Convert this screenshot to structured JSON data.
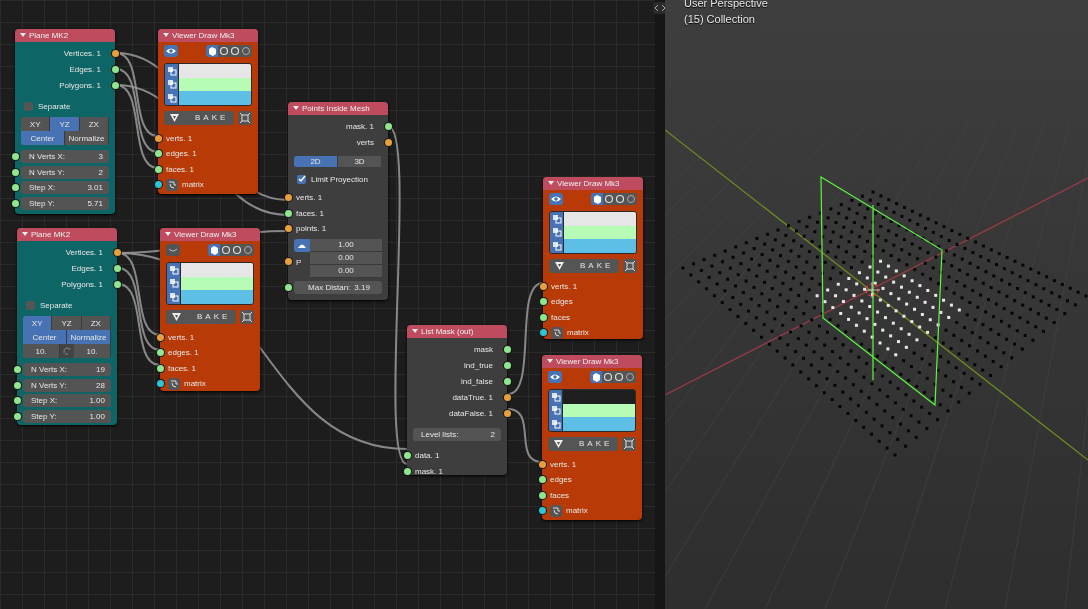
{
  "viewport": {
    "view_name": "User Perspective",
    "collection": "(15) Collection"
  },
  "nodes": [
    {
      "kind": "plane",
      "title": "Plane MK2",
      "outputs": [
        {
          "label": "Vertices. 1",
          "color": "#e8a13a"
        },
        {
          "label": "Edges. 1",
          "color": "#8fe68f"
        },
        {
          "label": "Polygons. 1",
          "color": "#8fe68f"
        }
      ],
      "separate": {
        "label": "Separate",
        "checked": false
      },
      "axes": [
        {
          "label": "XY",
          "selected": false
        },
        {
          "label": "YZ",
          "selected": true
        },
        {
          "label": "ZX",
          "selected": false
        }
      ],
      "options": [
        {
          "label": "Center",
          "selected": true
        },
        {
          "label": "Normalize",
          "selected": false
        }
      ],
      "fields": [
        {
          "label": "N Verts X:",
          "value": "3",
          "color": "#8fe68f"
        },
        {
          "label": "N Verts Y:",
          "value": "2",
          "color": "#8fe68f"
        },
        {
          "label": "Step X:",
          "value": "3.01",
          "color": "#8fe68f"
        },
        {
          "label": "Step Y:",
          "value": "5.71",
          "color": "#8fe68f"
        }
      ]
    },
    {
      "kind": "viewer",
      "title": "Viewer Draw Mk3",
      "visible": true,
      "colors": [
        {
          "color": "#e6e6e6"
        },
        {
          "color": "#b6fbb6"
        },
        {
          "color": "#5ebfe6"
        }
      ],
      "bake": "BAKE",
      "inputs": [
        {
          "kind": "socket",
          "label": "verts. 1",
          "color": "#e8a13a"
        },
        {
          "kind": "socket",
          "label": "edges. 1",
          "color": "#8fe68f"
        },
        {
          "kind": "socket",
          "label": "faces. 1",
          "color": "#8fe68f"
        },
        {
          "kind": "matrix",
          "label": "matrix",
          "color": "#2fc3d6"
        }
      ]
    },
    {
      "kind": "plane",
      "title": "Plane MK2",
      "outputs": [
        {
          "label": "Vertices. 1",
          "color": "#e8a13a"
        },
        {
          "label": "Edges. 1",
          "color": "#8fe68f"
        },
        {
          "label": "Polygons. 1",
          "color": "#8fe68f"
        }
      ],
      "separate": {
        "label": "Separate",
        "checked": false
      },
      "axes": [
        {
          "label": "XY",
          "selected": true
        },
        {
          "label": "YZ",
          "selected": false
        },
        {
          "label": "ZX",
          "selected": false
        }
      ],
      "options": [
        {
          "label": "Center",
          "selected": true
        },
        {
          "label": "Normalize",
          "selected": true
        }
      ],
      "size": [
        "10.",
        "10."
      ],
      "fields": [
        {
          "label": "N Verts X:",
          "value": "19",
          "color": "#8fe68f"
        },
        {
          "label": "N Verts Y:",
          "value": "28",
          "color": "#8fe68f"
        },
        {
          "label": "Step X:",
          "value": "1.00",
          "color": "#8fe68f"
        },
        {
          "label": "Step Y:",
          "value": "1.00",
          "color": "#8fe68f"
        }
      ]
    },
    {
      "kind": "viewer",
      "title": "Viewer Draw Mk3",
      "visible": false,
      "colors": [
        {
          "color": "#e6e6e6"
        },
        {
          "color": "#b6fbb6"
        },
        {
          "color": "#5ebfe6"
        }
      ],
      "bake": "BAKE",
      "inputs": [
        {
          "kind": "socket",
          "label": "verts. 1",
          "color": "#e8a13a"
        },
        {
          "kind": "socket",
          "label": "edges. 1",
          "color": "#8fe68f"
        },
        {
          "kind": "socket",
          "label": "faces. 1",
          "color": "#8fe68f"
        },
        {
          "kind": "matrix",
          "label": "matrix",
          "color": "#2fc3d6"
        }
      ]
    },
    {
      "kind": "points",
      "title": "Points Inside Mesh",
      "outputs": [
        {
          "label": "mask. 1",
          "color": "#8fe68f"
        },
        {
          "label": "verts",
          "color": "#e8a13a"
        }
      ],
      "modes": [
        {
          "label": "2D",
          "selected": true
        },
        {
          "label": "3D",
          "selected": false
        }
      ],
      "limit": {
        "label": "Limit Proyection",
        "checked": true
      },
      "inputs": [
        {
          "label": "verts. 1",
          "color": "#e8a13a"
        },
        {
          "label": "faces. 1",
          "color": "#8fe68f"
        },
        {
          "label": "points. 1",
          "color": "#e8a13a"
        }
      ],
      "vector": {
        "label": "P",
        "color": "#e8a13a",
        "values": [
          "1.00",
          "0.00",
          "0.00"
        ]
      },
      "max_distance": {
        "label": "Max Distan:",
        "value": "3.19",
        "color": "#8fe68f"
      }
    },
    {
      "kind": "listmask",
      "title": "List Mask (out)",
      "outputs": [
        {
          "label": "mask",
          "color": "#8fe68f"
        },
        {
          "label": "ind_true",
          "color": "#8fe68f"
        },
        {
          "label": "ind_false",
          "color": "#8fe68f"
        },
        {
          "label": "dataTrue. 1",
          "color": "#e8a13a"
        },
        {
          "label": "dataFalse. 1",
          "color": "#e8a13a"
        }
      ],
      "level": {
        "label": "Level lists:",
        "value": "2"
      },
      "inputs": [
        {
          "label": "data. 1",
          "color": "#8fe68f"
        },
        {
          "label": "mask. 1",
          "color": "#8fe68f"
        }
      ]
    },
    {
      "kind": "viewer",
      "title": "Viewer Draw Mk3",
      "visible": true,
      "colors": [
        {
          "color": "#e6e6e6"
        },
        {
          "color": "#b6fbb6"
        },
        {
          "color": "#5ebfe6"
        }
      ],
      "bake": "BAKE",
      "inputs": [
        {
          "kind": "socket",
          "label": "verts. 1",
          "color": "#e8a13a"
        },
        {
          "kind": "socket",
          "label": "edges",
          "color": "#8fe68f"
        },
        {
          "kind": "socket",
          "label": "faces",
          "color": "#8fe68f"
        },
        {
          "kind": "matrix",
          "label": "matrix",
          "color": "#2fc3d6"
        }
      ]
    },
    {
      "kind": "viewer",
      "title": "Viewer Draw Mk3",
      "visible": true,
      "colors": [
        {
          "color": "#1e1e1e"
        },
        {
          "color": "#b6fbb6"
        },
        {
          "color": "#5ebfe6"
        }
      ],
      "bake": "BAKE",
      "inputs": [
        {
          "kind": "socket",
          "label": "verts. 1",
          "color": "#e8a13a"
        },
        {
          "kind": "socket",
          "label": "edges",
          "color": "#8fe68f"
        },
        {
          "kind": "socket",
          "label": "faces",
          "color": "#8fe68f"
        },
        {
          "kind": "matrix",
          "label": "matrix",
          "color": "#2fc3d6"
        }
      ]
    }
  ]
}
